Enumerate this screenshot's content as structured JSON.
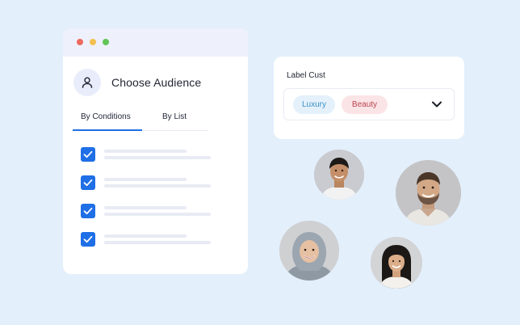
{
  "window": {
    "controls": [
      "close",
      "minimize",
      "maximize"
    ],
    "colors": {
      "close": "#ec6a5e",
      "minimize": "#f4bf4f",
      "maximize": "#61c554"
    }
  },
  "audience": {
    "title": "Choose Audience",
    "icon": "user-icon"
  },
  "tabs": [
    {
      "label": "By Conditions",
      "active": true
    },
    {
      "label": "By List",
      "active": false
    }
  ],
  "conditions": [
    {
      "checked": true
    },
    {
      "checked": true
    },
    {
      "checked": true
    },
    {
      "checked": true
    }
  ],
  "label_field": {
    "label": "Label Cust",
    "tags": [
      {
        "label": "Luxury",
        "color": "#3d8fc6"
      },
      {
        "label": "Beauty",
        "color": "#b9434f"
      }
    ],
    "dropdown_icon": "chevron-down-icon"
  },
  "colors": {
    "accent": "#1f6fe6",
    "background": "#e3effb"
  },
  "people": [
    "young-man-portrait",
    "bearded-man-portrait",
    "woman-hijab-portrait",
    "young-woman-portrait"
  ]
}
